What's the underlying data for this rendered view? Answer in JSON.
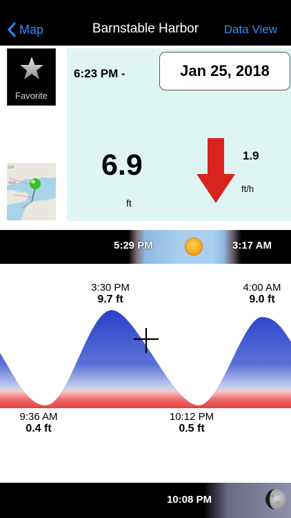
{
  "nav": {
    "back_label": "Map",
    "title": "Barnstable Harbor",
    "right_label": "Data View"
  },
  "favorite": {
    "label": "Favorite",
    "icon": "star-icon"
  },
  "map_thumbnail": {
    "icon": "map-pin-icon"
  },
  "info": {
    "time": "6:23 PM -",
    "date": "Jan 25, 2018",
    "height": "6.9",
    "height_unit": "ft",
    "trend": "falling",
    "trend_icon": "down-arrow-icon",
    "rate": "1.9",
    "rate_unit": "ft/h"
  },
  "sun": {
    "sunrise": "5:29 PM",
    "sunset": "3:17 AM",
    "icon": "sun-icon"
  },
  "tides": {
    "high": [
      {
        "time": "3:30 PM",
        "height": "9.7 ft"
      },
      {
        "time": "4:00 AM",
        "height": "9.0 ft"
      }
    ],
    "low": [
      {
        "time": "9:36 AM",
        "height": "0.4 ft"
      },
      {
        "time": "10:12 PM",
        "height": "0.5 ft"
      }
    ]
  },
  "moon": {
    "time": "10:08 PM",
    "icon": "moon-icon"
  },
  "colors": {
    "accent": "#2f8cff",
    "panel": "#dff5f4",
    "arrow": "#d9231d",
    "water_high": "#2b3fc9",
    "water_low": "#e23a3a"
  }
}
